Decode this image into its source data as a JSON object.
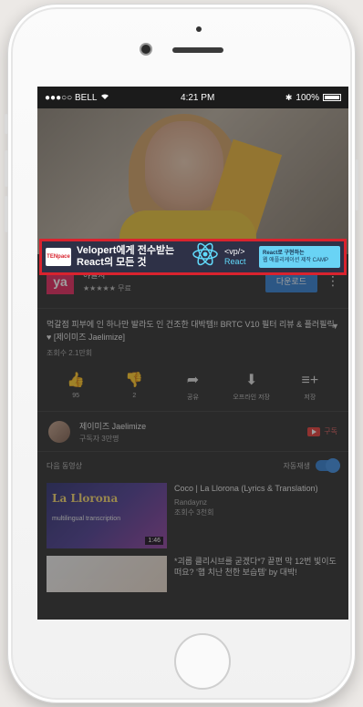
{
  "status_bar": {
    "carrier": "●●●○○ BELL",
    "wifi_icon": "wifi-icon",
    "time": "4:21 PM",
    "bluetooth_icon": "bluetooth-icon",
    "battery_percent": "100%",
    "battery_level": 1.0
  },
  "ad_banner": {
    "brand": "TENpace",
    "headline_line1": "Velopert에게 전수받는",
    "headline_line2": "React의 모든 것",
    "react_icon": "react-atom-icon",
    "vp_line1": "<vp/>",
    "vp_line2": "React",
    "cta_line1": "React로 구현하는",
    "cta_line2": "웹 애플리케이션 제작 CAMP",
    "cta_arrow": ">",
    "accent_color": "#d9232e",
    "cta_color": "#69d3f5"
  },
  "channel": {
    "logo": "ya",
    "name": "야놀자",
    "rating": "★★★★★",
    "rating_label": "무료",
    "subscribe_label": "다운로드",
    "menu_icon": "⋮"
  },
  "video": {
    "title": "먹갈점 피부에 인 하나만 발라도 인 건조한 대박템!! BRTC V10 필터 리뷰 & 플러필릭 ♥ [제이미즈 Jaelimize]",
    "views": "조회수 2.1만회",
    "expand_icon": "▼"
  },
  "actions": [
    {
      "icon": "thumbs-up-icon",
      "glyph": "👍",
      "label": "95"
    },
    {
      "icon": "thumbs-down-icon",
      "glyph": "👎",
      "label": "2"
    },
    {
      "icon": "share-icon",
      "glyph": "➦",
      "label": "공유"
    },
    {
      "icon": "download-icon",
      "glyph": "⬇",
      "label": "오프라인 저장"
    },
    {
      "icon": "add-to-playlist-icon",
      "glyph": "≡+",
      "label": "저장"
    }
  ],
  "uploader": {
    "name": "제이미즈 Jaelimize",
    "subscribers": "구독자 3만명",
    "subscribe_label": "구독"
  },
  "up_next": {
    "label": "다음 동영상",
    "autoplay_label": "자동재생",
    "autoplay_on": true
  },
  "next_videos": [
    {
      "thumb_title": "La Llorona",
      "thumb_sub": "multilingual transcription",
      "duration": "1:46",
      "title": "Coco | La Llorona (Lyrics & Translation)",
      "channel": "Randaynz",
      "views": "조회수 3천회"
    },
    {
      "thumb_title": "",
      "thumb_sub": "",
      "duration": "",
      "title": "*괴롭 클리시브를 굳겠다*7 끝편 막 12번 빛이도 떠요? '햅 치난 천한 보습템' by 대박!",
      "channel": "",
      "views": ""
    }
  ]
}
